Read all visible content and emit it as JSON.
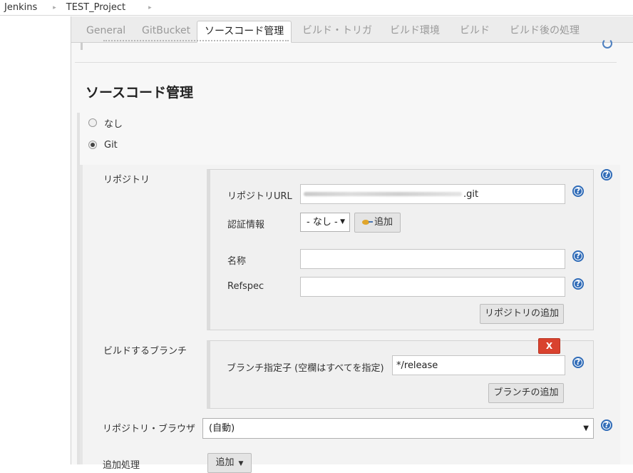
{
  "breadcrumb": {
    "items": [
      "Jenkins",
      "TEST_Project"
    ],
    "separator": "▸"
  },
  "tabs": [
    {
      "label": "General"
    },
    {
      "label": "GitBucket"
    },
    {
      "label": "ソースコード管理"
    },
    {
      "label": "ビルド・トリガ"
    },
    {
      "label": "ビルド環境"
    },
    {
      "label": "ビルド"
    },
    {
      "label": "ビルド後の処理"
    }
  ],
  "section": {
    "title": "ソースコード管理"
  },
  "scm": {
    "options": [
      {
        "label": "なし",
        "checked": false
      },
      {
        "label": "Git",
        "checked": true
      }
    ]
  },
  "repositories": {
    "label": "リポジトリ",
    "url_label": "リポジトリURL",
    "url_value": ".git",
    "credentials_label": "認証情報",
    "credentials_value": "- なし -",
    "add_credentials_label": "追加",
    "name_label": "名称",
    "name_value": "",
    "refspec_label": "Refspec",
    "refspec_value": "",
    "add_repository_label": "リポジトリの追加"
  },
  "branches": {
    "label": "ビルドするブランチ",
    "delete_label": "X",
    "specifier_label": "ブランチ指定子 (空欄はすべてを指定)",
    "specifier_value": "*/release",
    "add_branch_label": "ブランチの追加"
  },
  "browser": {
    "label": "リポジトリ・ブラウザ",
    "value": "(自動)"
  },
  "extensions": {
    "label": "追加処理",
    "add_label": "追加"
  },
  "help_glyph": "?",
  "colors": {
    "accent": "#2f6bb7",
    "danger": "#d9422e"
  }
}
